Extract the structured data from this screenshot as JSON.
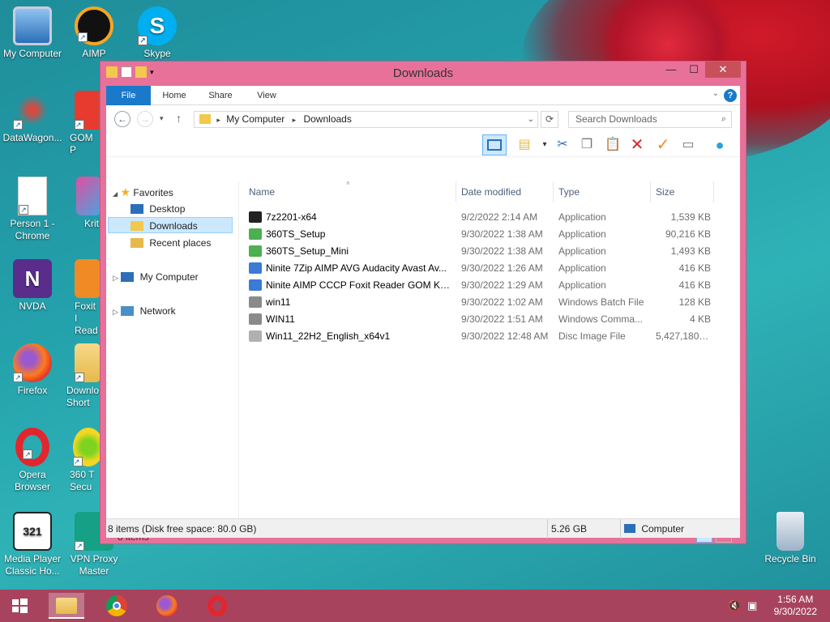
{
  "colors": {
    "window_frame": "#e8719a",
    "close_button": "#c7505a",
    "taskbar": "#a8435e",
    "ribbon_file_tab": "#1979ca",
    "selection": "#cce8ff"
  },
  "desktop_icons": [
    {
      "label": "My Computer",
      "icon": "computer-icon"
    },
    {
      "label": "AIMP",
      "icon": "aimp-icon"
    },
    {
      "label": "Skype",
      "icon": "skype-icon"
    },
    {
      "label": "DataWagon...",
      "icon": "datawagon-icon"
    },
    {
      "label": "GOM P",
      "icon": "gom-player-icon"
    },
    {
      "label": "Person 1 - Chrome",
      "icon": "chrome-profile-icon"
    },
    {
      "label": "Krit",
      "icon": "krita-icon"
    },
    {
      "label": "NVDA",
      "icon": "nvda-icon"
    },
    {
      "label": "Foxit I Read",
      "icon": "foxit-reader-icon"
    },
    {
      "label": "Firefox",
      "icon": "firefox-icon"
    },
    {
      "label": "Downlo Short",
      "icon": "folder-shortcut-icon"
    },
    {
      "label": "Opera Browser",
      "icon": "opera-icon"
    },
    {
      "label": "360 T Secu",
      "icon": "360-security-icon"
    },
    {
      "label": "Media Player Classic Ho...",
      "icon": "mpc-icon"
    },
    {
      "label": "VPN Proxy Master",
      "icon": "vpn-icon"
    },
    {
      "label": "Recycle Bin",
      "icon": "recycle-bin-icon"
    }
  ],
  "window": {
    "title": "Downloads",
    "controls": {
      "minimize": "—",
      "maximize": "☐",
      "close": "✕"
    },
    "ribbon_tabs": [
      "File",
      "Home",
      "Share",
      "View"
    ],
    "address": {
      "path": [
        "My Computer",
        "Downloads"
      ]
    },
    "search": {
      "placeholder": "Search Downloads"
    },
    "nav": {
      "favorites": "Favorites",
      "desktop": "Desktop",
      "downloads": "Downloads",
      "recent": "Recent places",
      "my_computer": "My Computer",
      "network": "Network"
    },
    "columns": [
      "Name",
      "Date modified",
      "Type",
      "Size"
    ],
    "files": [
      {
        "name": "7z2201-x64",
        "date": "9/2/2022 2:14 AM",
        "type": "Application",
        "size": "1,539 KB",
        "icon": "7zip-icon",
        "color": "#222222"
      },
      {
        "name": "360TS_Setup",
        "date": "9/30/2022 1:38 AM",
        "type": "Application",
        "size": "90,216 KB",
        "icon": "360-setup-icon",
        "color": "#4caf50"
      },
      {
        "name": "360TS_Setup_Mini",
        "date": "9/30/2022 1:38 AM",
        "type": "Application",
        "size": "1,493 KB",
        "icon": "360-setup-icon",
        "color": "#4caf50"
      },
      {
        "name": "Ninite 7Zip AIMP AVG Audacity Avast Av...",
        "date": "9/30/2022 1:26 AM",
        "type": "Application",
        "size": "416 KB",
        "icon": "ninite-icon",
        "color": "#3a7bd5"
      },
      {
        "name": "Ninite AIMP CCCP Foxit Reader GOM Krit...",
        "date": "9/30/2022 1:29 AM",
        "type": "Application",
        "size": "416 KB",
        "icon": "ninite-icon",
        "color": "#3a7bd5"
      },
      {
        "name": "win11",
        "date": "9/30/2022 1:02 AM",
        "type": "Windows Batch File",
        "size": "128 KB",
        "icon": "batch-file-icon",
        "color": "#8a8a8a"
      },
      {
        "name": "WIN11",
        "date": "9/30/2022 1:51 AM",
        "type": "Windows Comma...",
        "size": "4 KB",
        "icon": "cmd-file-icon",
        "color": "#8a8a8a"
      },
      {
        "name": "Win11_22H2_English_x64v1",
        "date": "9/30/2022 12:48 AM",
        "type": "Disc Image File",
        "size": "5,427,180 KB",
        "icon": "disc-image-icon",
        "color": "#b0b0b0"
      }
    ],
    "items_count": "8 items",
    "status": {
      "left": "8 items (Disk free space: 80.0 GB)",
      "size": "5.26 GB",
      "location": "Computer"
    }
  },
  "taskbar": {
    "apps": [
      "start-icon",
      "file-explorer-icon",
      "chrome-icon",
      "firefox-icon",
      "opera-icon"
    ],
    "time": "1:56 AM",
    "date": "9/30/2022"
  }
}
